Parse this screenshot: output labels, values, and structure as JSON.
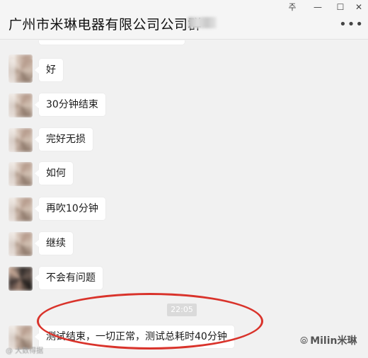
{
  "header": {
    "title": "广州市米琳电器有限公司公司群",
    "window_controls": {
      "pin": "주",
      "minimize": "—",
      "maximize": "☐",
      "close": "✕"
    },
    "more": "•••"
  },
  "messages": [
    {
      "text": "好"
    },
    {
      "text": "30分钟结束"
    },
    {
      "text": "完好无损"
    },
    {
      "text": "如何"
    },
    {
      "text": "再吹10分钟"
    },
    {
      "text": "继续"
    },
    {
      "text": "不会有问题"
    },
    {
      "text": "测试结束，一切正常，测试总耗时40分钟"
    }
  ],
  "timestamp": "22:05",
  "watermark": {
    "right": "Milin米琳",
    "left": "@ 大数得据"
  },
  "colors": {
    "highlight_oval": "#d9332b",
    "bubble": "#ffffff",
    "background": "#f1f1f1"
  }
}
